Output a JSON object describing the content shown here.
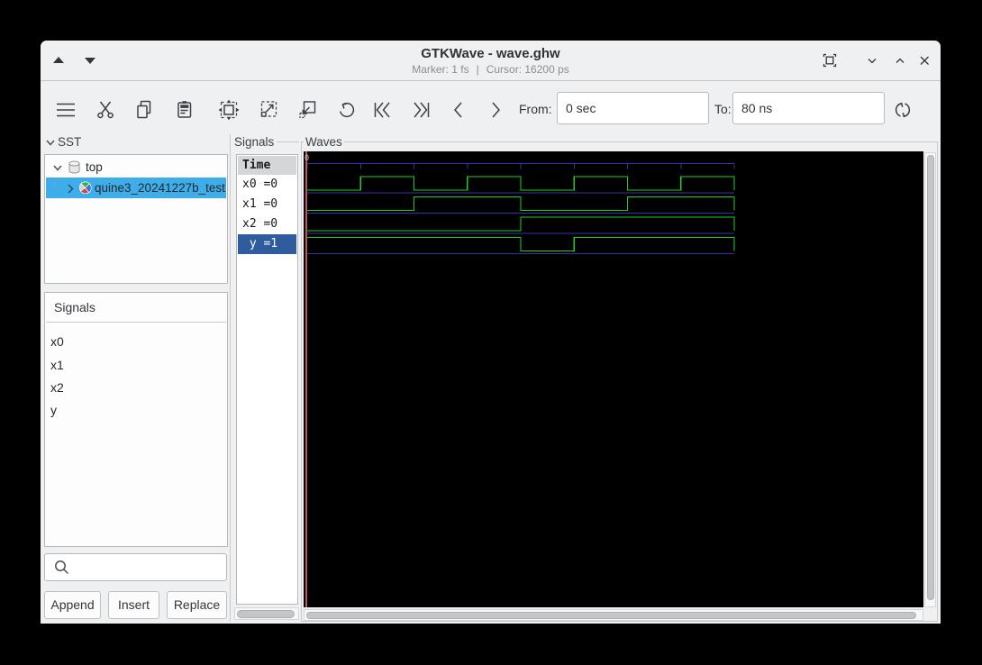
{
  "window": {
    "title": "GTKWave - wave.ghw",
    "subtitle_marker": "Marker: 1 fs",
    "subtitle_sep": "|",
    "subtitle_cursor": "Cursor: 16200 ps"
  },
  "toolbar": {
    "from_label": "From:",
    "from_value": "0 sec",
    "to_label": "To:",
    "to_value": "80 ns",
    "icons": [
      "menu",
      "cut",
      "copy",
      "paste",
      "zoom-fit",
      "zoom-out",
      "zoom-in",
      "undo",
      "to-start",
      "to-end",
      "step-left",
      "step-right",
      "reload"
    ]
  },
  "sst": {
    "header": "SST",
    "items": [
      {
        "label": "top",
        "expanded": true
      },
      {
        "label": "quine3_20241227b_test",
        "selected": true
      }
    ]
  },
  "left_signals": {
    "header": "Signals",
    "items": [
      "x0",
      "x1",
      "x2",
      "y"
    ]
  },
  "actions": {
    "append": "Append",
    "insert": "Insert",
    "replace": "Replace"
  },
  "signals_panel": {
    "frame_label": "Signals",
    "header": "Time",
    "rows": [
      {
        "text": "x0 =0",
        "selected": false
      },
      {
        "text": "x1 =0",
        "selected": false
      },
      {
        "text": "x2 =0",
        "selected": false
      },
      {
        "text": " y =1",
        "selected": true
      }
    ]
  },
  "waves_panel": {
    "frame_label": "Waves",
    "origin_label": "0"
  },
  "chart_data": {
    "type": "digital",
    "time_unit": "ns",
    "t_start": 0,
    "t_end": 80,
    "timeline_tick_interval": 10,
    "signals": [
      {
        "name": "x0",
        "initial": 0,
        "transitions": [
          10,
          20,
          30,
          40,
          50,
          60,
          70
        ]
      },
      {
        "name": "x1",
        "initial": 0,
        "transitions": [
          20,
          40,
          60
        ]
      },
      {
        "name": "x2",
        "initial": 0,
        "transitions": [
          40
        ]
      },
      {
        "name": "y",
        "initial": 1,
        "transitions": [
          40,
          50
        ]
      }
    ],
    "colors": {
      "trace": "#1fd11f",
      "separator": "#3434ae",
      "timeline": "#3434ae",
      "marker": "#c75050",
      "background": "#000000"
    }
  }
}
